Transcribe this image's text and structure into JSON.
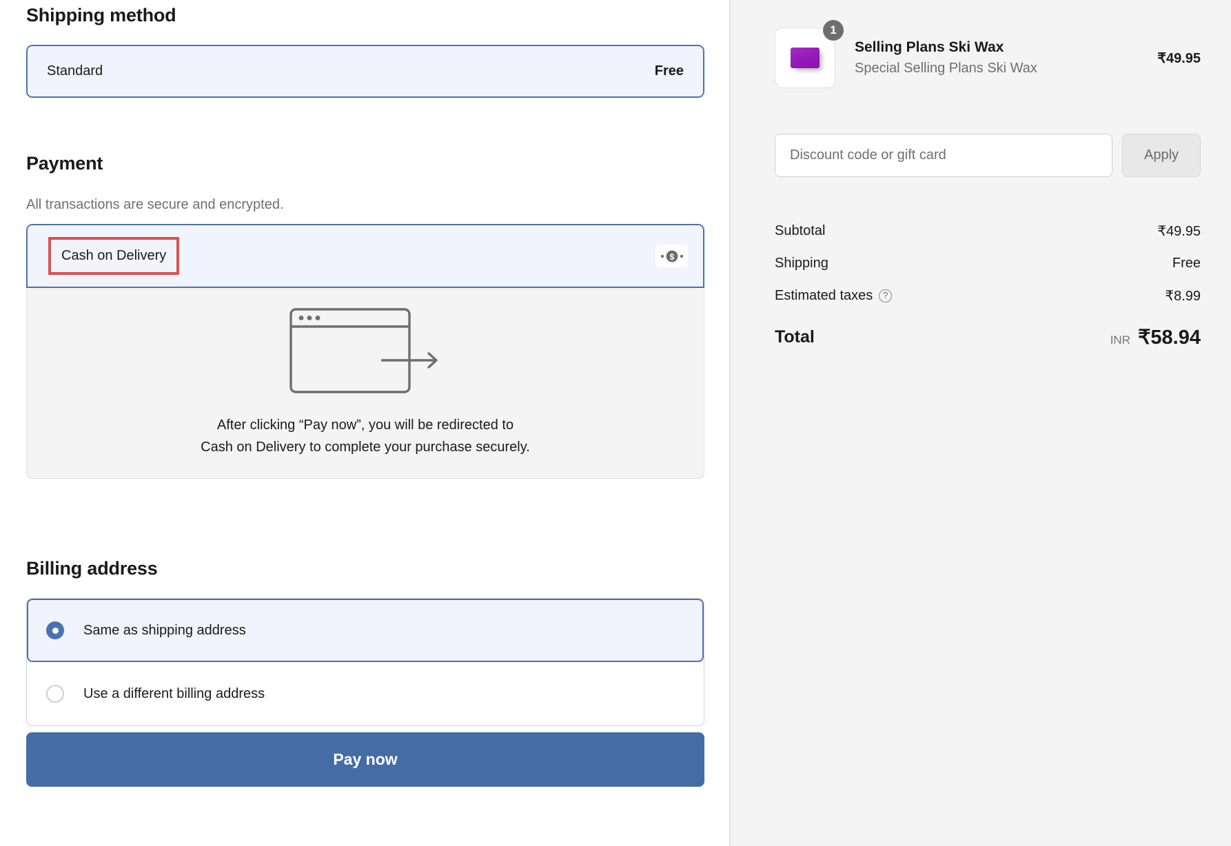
{
  "shipping": {
    "heading": "Shipping method",
    "option_name": "Standard",
    "option_price": "Free"
  },
  "payment": {
    "heading": "Payment",
    "subheading": "All transactions are secure and encrypted.",
    "method_label": "Cash on Delivery",
    "method_icon": "banknote-dollar-icon",
    "redirect_line1": "After clicking “Pay now”, you will be redirected to",
    "redirect_line2": "Cash on Delivery to complete your purchase securely.",
    "illustration_icon": "browser-window-redirect-arrow-icon",
    "annotation_color": "#d9534f"
  },
  "billing": {
    "heading": "Billing address",
    "options": [
      {
        "label": "Same as shipping address",
        "selected": true
      },
      {
        "label": "Use a different billing address",
        "selected": false
      }
    ]
  },
  "actions": {
    "pay_now_label": "Pay now"
  },
  "summary": {
    "item": {
      "title": "Selling Plans Ski Wax",
      "variant": "Special Selling Plans Ski Wax",
      "price": "₹49.95",
      "quantity": "1",
      "thumbnail_icon": "ski-wax-bar-icon"
    },
    "discount": {
      "placeholder": "Discount code or gift card",
      "value": "",
      "apply_label": "Apply"
    },
    "rows": [
      {
        "label": "Subtotal",
        "value": "₹49.95",
        "help": false
      },
      {
        "label": "Shipping",
        "value": "Free",
        "help": false
      },
      {
        "label": "Estimated taxes",
        "value": "₹8.99",
        "help": true
      }
    ],
    "total": {
      "label": "Total",
      "currency_code": "INR",
      "value": "₹58.94"
    }
  },
  "colors": {
    "accent_blue": "#456ca5",
    "selected_bg": "#f1f4fd",
    "annotation_red": "#d9534f",
    "panel_gray": "#f4f4f4"
  }
}
